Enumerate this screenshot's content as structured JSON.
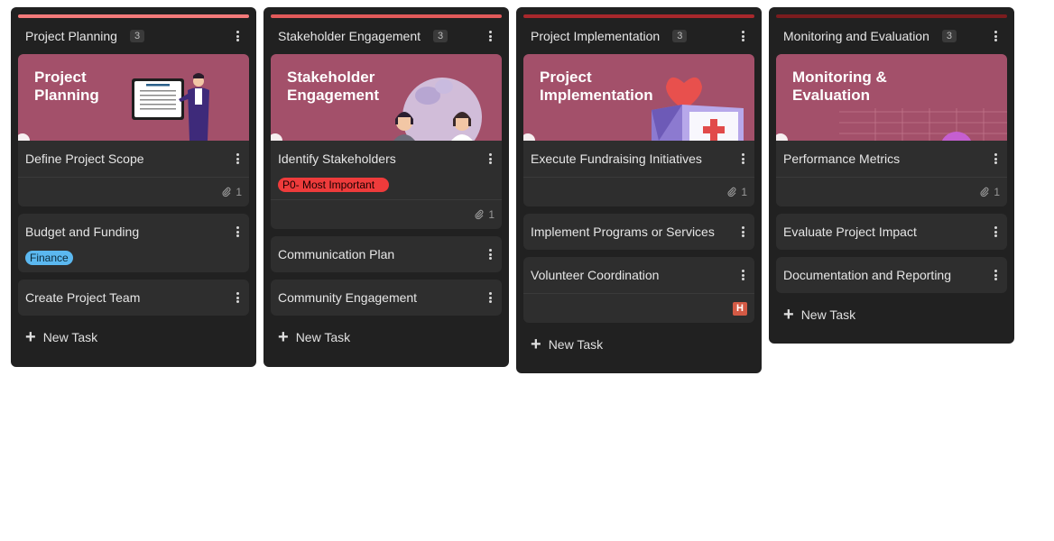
{
  "columns": [
    {
      "title": "Project Planning",
      "count": "3",
      "accent": "#f47a7a",
      "cover_text": "Project\nPlanning",
      "cards": [
        {
          "title": "Define Project Scope",
          "attachments": "1"
        },
        {
          "title": "Budget and Funding",
          "tag": "Finance"
        },
        {
          "title": "Create Project Team"
        }
      ],
      "new_task": "New Task"
    },
    {
      "title": "Stakeholder Engagement",
      "count": "3",
      "accent": "#e25a5a",
      "cover_text": "Stakeholder\nEngagement",
      "cards": [
        {
          "title": "Identify Stakeholders",
          "tag": "P0- Most Important",
          "attachments": "1"
        },
        {
          "title": "Communication Plan"
        },
        {
          "title": "Community Engagement"
        }
      ],
      "new_task": "New Task"
    },
    {
      "title": "Project Implementation",
      "count": "3",
      "accent": "#a8282c",
      "cover_text": "Project\nImplementation",
      "cards": [
        {
          "title": "Execute Fundraising Initiatives",
          "attachments": "1"
        },
        {
          "title": "Implement Programs or Services"
        },
        {
          "title": "Volunteer Coordination",
          "badge": "H"
        }
      ],
      "new_task": "New Task"
    },
    {
      "title": "Monitoring and Evaluation",
      "count": "3",
      "accent": "#7b1c1e",
      "cover_text": "Monitoring &\nEvaluation",
      "cards": [
        {
          "title": "Performance Metrics",
          "attachments": "1"
        },
        {
          "title": "Evaluate Project Impact"
        },
        {
          "title": "Documentation and Reporting"
        }
      ],
      "new_task": "New Task"
    }
  ],
  "colors": {
    "tag_finance": "#5bb8f0",
    "tag_p0": "#ee3b3b",
    "cover_bg": "#a3506a",
    "badge_h": "#d35a45"
  },
  "icons": [
    "more-vert-icon",
    "paperclip-icon",
    "plus-icon",
    "priority-h-icon"
  ]
}
